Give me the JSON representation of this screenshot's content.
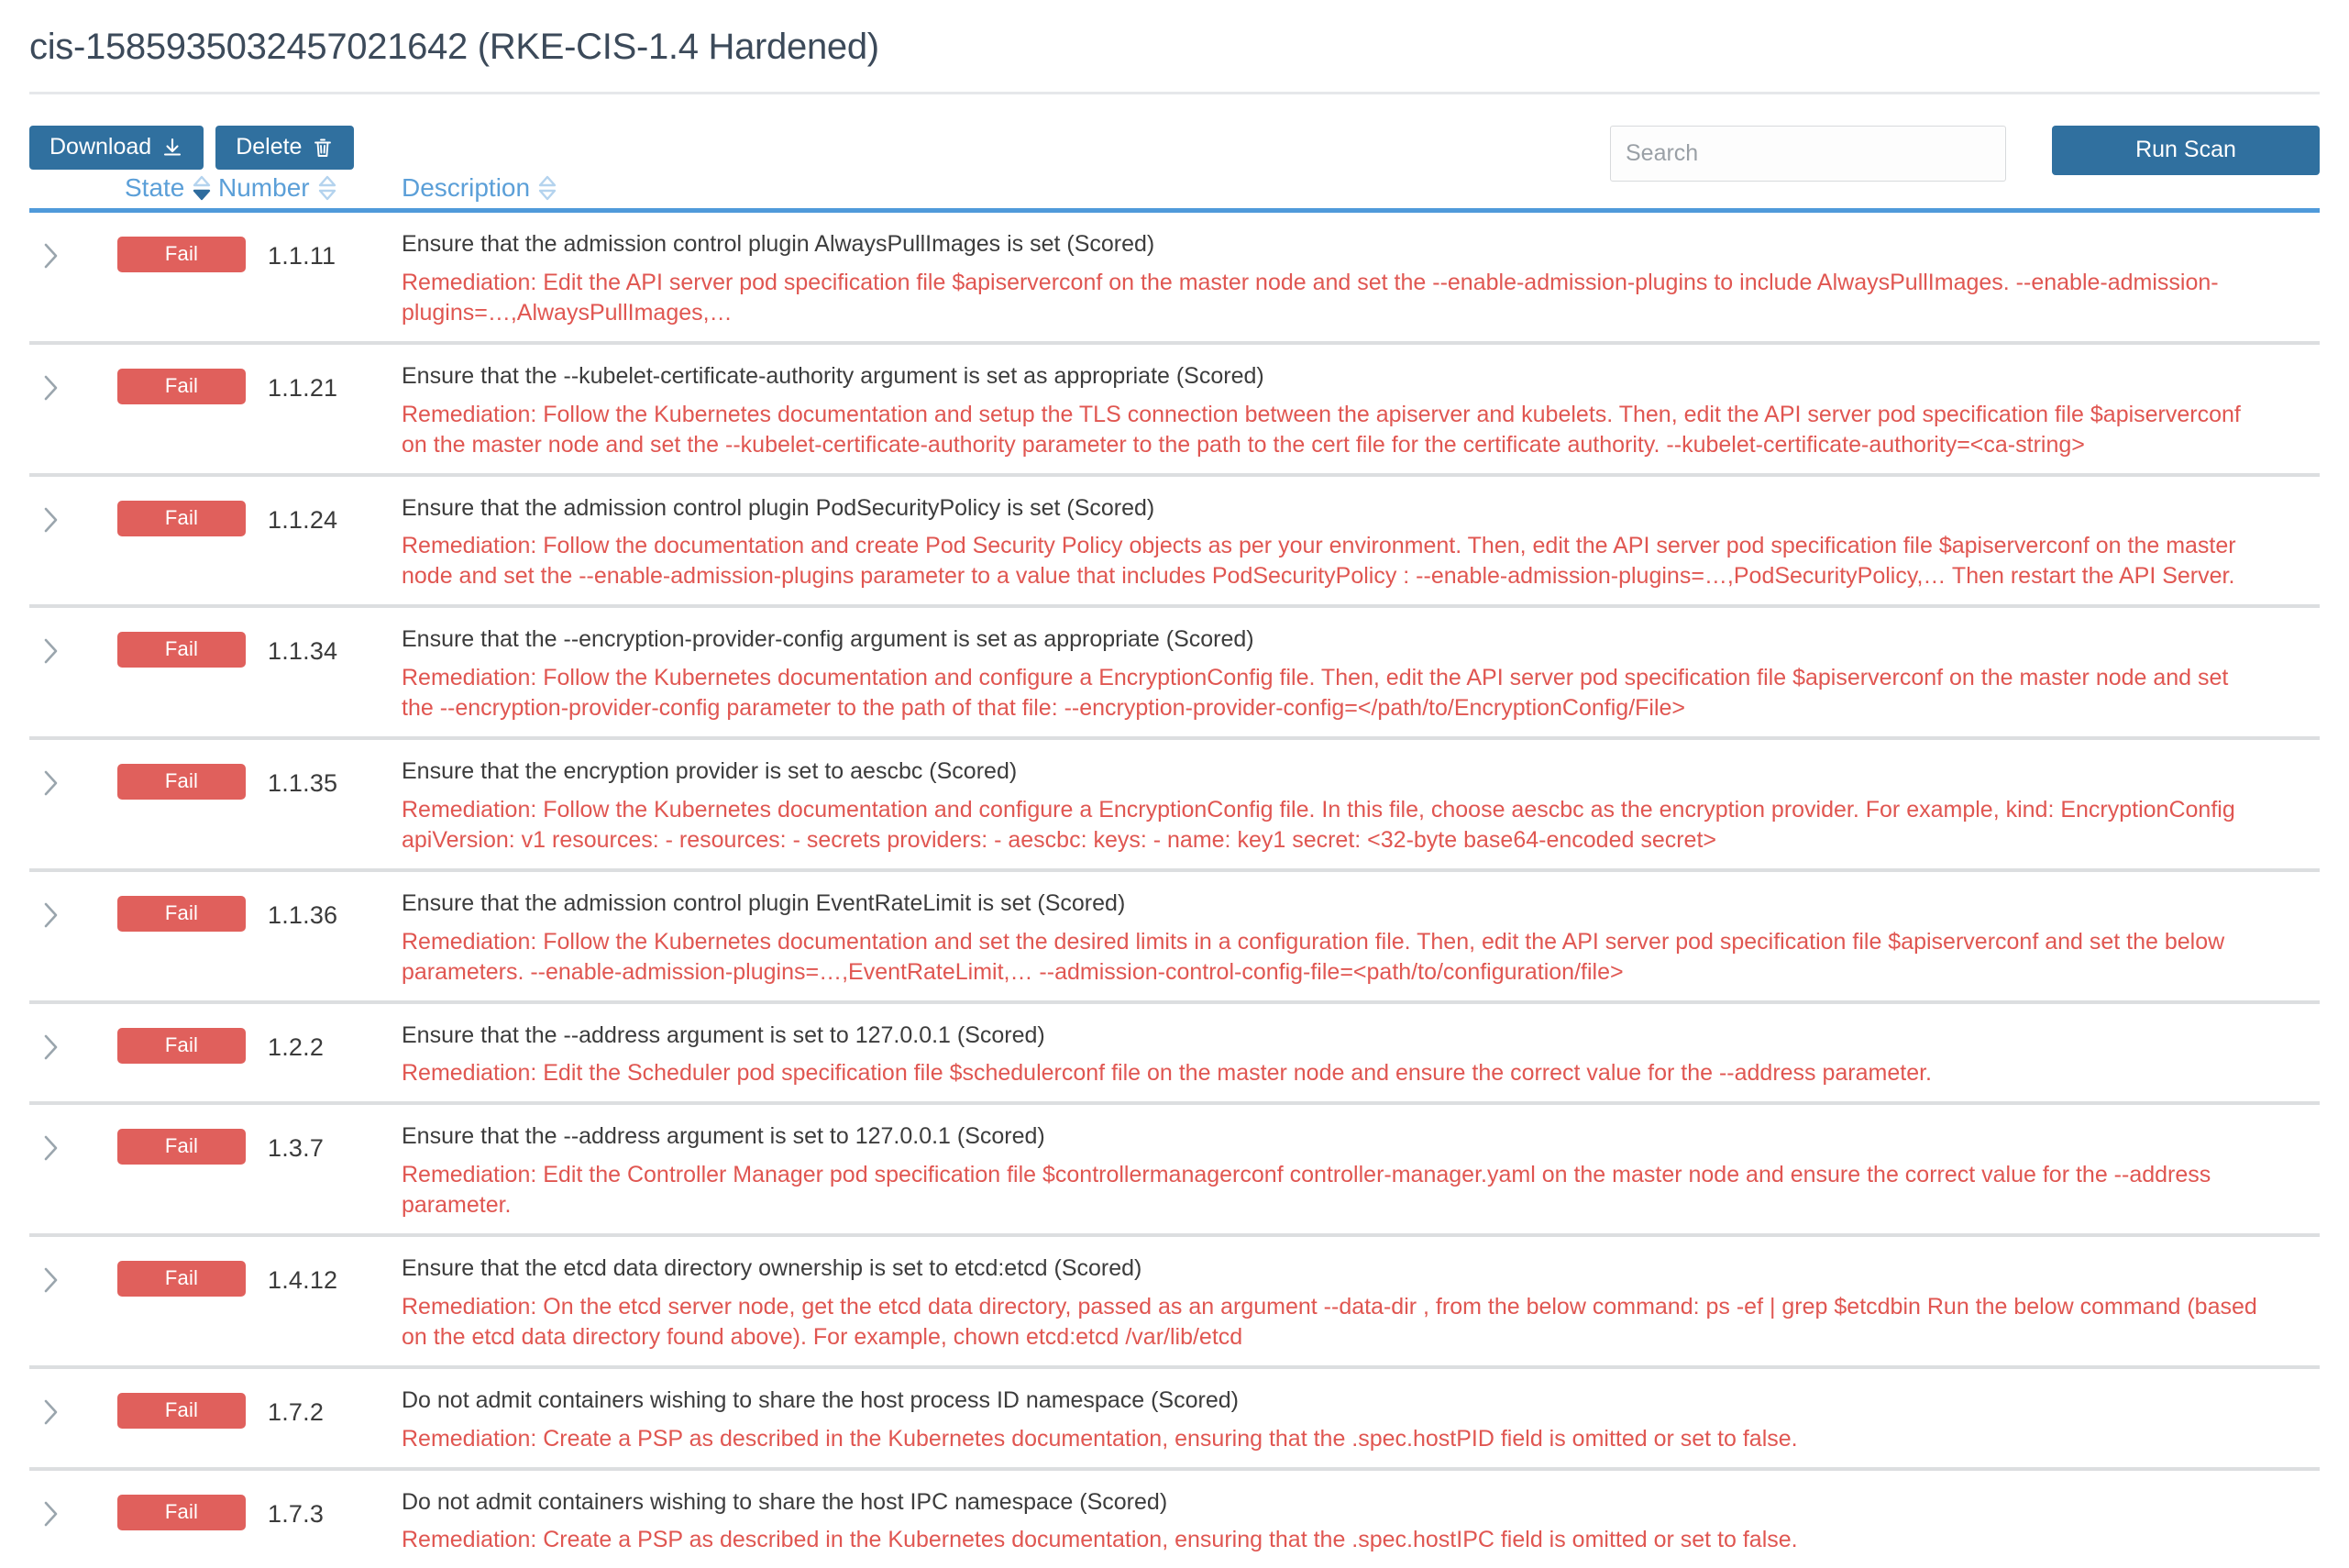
{
  "header": {
    "title": "cis-1585935032457021642 (RKE-CIS-1.4 Hardened)"
  },
  "toolbar": {
    "download_label": "Download",
    "download_icon": "download-icon",
    "delete_label": "Delete",
    "delete_icon": "trash-icon",
    "search_placeholder": "Search",
    "search_value": "",
    "run_scan_label": "Run Scan",
    "primary_color": "#30709f",
    "accent_color": "#4f9ada",
    "fail_color": "#e0605c"
  },
  "table": {
    "columns": [
      {
        "key": "state",
        "label": "State",
        "sortable": true,
        "sort": "desc"
      },
      {
        "key": "number",
        "label": "Number",
        "sortable": true,
        "sort": "none"
      },
      {
        "key": "description",
        "label": "Description",
        "sortable": true,
        "sort": "none"
      }
    ],
    "rows": [
      {
        "state": "Fail",
        "number": "1.1.11",
        "description": "Ensure that the admission control plugin AlwaysPullImages is set (Scored)",
        "remediation": "Remediation: Edit the API server pod specification file $apiserverconf on the master node and set the --enable-admission-plugins to include AlwaysPullImages. --enable-admission-plugins=…,AlwaysPullImages,…"
      },
      {
        "state": "Fail",
        "number": "1.1.21",
        "description": "Ensure that the --kubelet-certificate-authority argument is set as appropriate (Scored)",
        "remediation": "Remediation: Follow the Kubernetes documentation and setup the TLS connection between the apiserver and kubelets. Then, edit the API server pod specification file $apiserverconf on the master node and set the --kubelet-certificate-authority parameter to the path to the cert file for the certificate authority. --kubelet-certificate-authority=<ca-string>"
      },
      {
        "state": "Fail",
        "number": "1.1.24",
        "description": "Ensure that the admission control plugin PodSecurityPolicy is set (Scored)",
        "remediation": "Remediation: Follow the documentation and create Pod Security Policy objects as per your environment. Then, edit the API server pod specification file $apiserverconf on the master node and set the --enable-admission-plugins parameter to a value that includes PodSecurityPolicy : --enable-admission-plugins=…,PodSecurityPolicy,… Then restart the API Server."
      },
      {
        "state": "Fail",
        "number": "1.1.34",
        "description": "Ensure that the --encryption-provider-config argument is set as appropriate (Scored)",
        "remediation": "Remediation: Follow the Kubernetes documentation and configure a EncryptionConfig file. Then, edit the API server pod specification file $apiserverconf on the master node and set the --encryption-provider-config parameter to the path of that file: --encryption-provider-config=</path/to/EncryptionConfig/File>"
      },
      {
        "state": "Fail",
        "number": "1.1.35",
        "description": "Ensure that the encryption provider is set to aescbc (Scored)",
        "remediation": "Remediation: Follow the Kubernetes documentation and configure a EncryptionConfig file. In this file, choose aescbc as the encryption provider. For example, kind: EncryptionConfig apiVersion: v1 resources: - resources: - secrets providers: - aescbc: keys: - name: key1 secret: <32-byte base64-encoded secret>"
      },
      {
        "state": "Fail",
        "number": "1.1.36",
        "description": "Ensure that the admission control plugin EventRateLimit is set (Scored)",
        "remediation": "Remediation: Follow the Kubernetes documentation and set the desired limits in a configuration file. Then, edit the API server pod specification file $apiserverconf and set the below parameters. --enable-admission-plugins=…,EventRateLimit,… --admission-control-config-file=<path/to/configuration/file>"
      },
      {
        "state": "Fail",
        "number": "1.2.2",
        "description": "Ensure that the --address argument is set to 127.0.0.1 (Scored)",
        "remediation": "Remediation: Edit the Scheduler pod specification file $schedulerconf file on the master node and ensure the correct value for the --address parameter."
      },
      {
        "state": "Fail",
        "number": "1.3.7",
        "description": "Ensure that the --address argument is set to 127.0.0.1 (Scored)",
        "remediation": "Remediation: Edit the Controller Manager pod specification file $controllermanagerconf controller-manager.yaml on the master node and ensure the correct value for the --address parameter."
      },
      {
        "state": "Fail",
        "number": "1.4.12",
        "description": "Ensure that the etcd data directory ownership is set to etcd:etcd (Scored)",
        "remediation": "Remediation: On the etcd server node, get the etcd data directory, passed as an argument --data-dir , from the below command: ps -ef | grep $etcdbin Run the below command (based on the etcd data directory found above). For example, chown etcd:etcd /var/lib/etcd"
      },
      {
        "state": "Fail",
        "number": "1.7.2",
        "description": "Do not admit containers wishing to share the host process ID namespace (Scored)",
        "remediation": "Remediation: Create a PSP as described in the Kubernetes documentation, ensuring that the .spec.hostPID field is omitted or set to false."
      },
      {
        "state": "Fail",
        "number": "1.7.3",
        "description": "Do not admit containers wishing to share the host IPC namespace (Scored)",
        "remediation": "Remediation: Create a PSP as described in the Kubernetes documentation, ensuring that the .spec.hostIPC field is omitted or set to false."
      }
    ]
  }
}
